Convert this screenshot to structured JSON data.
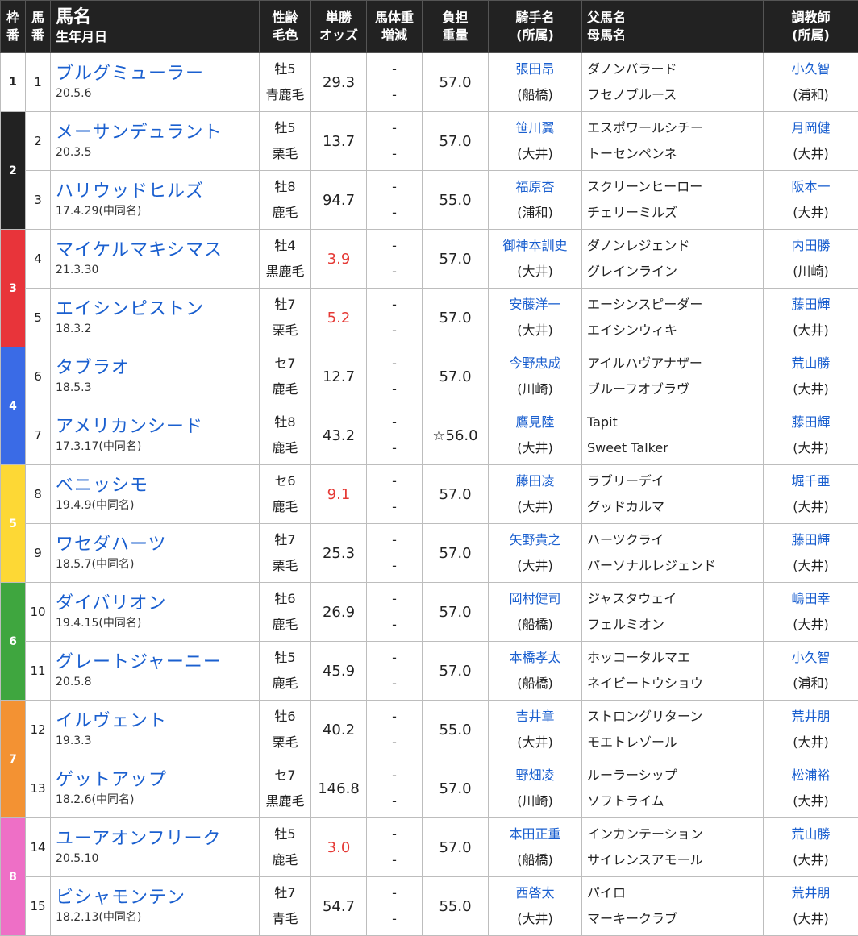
{
  "header": {
    "waku": [
      "枠",
      "番"
    ],
    "umaban": [
      "馬",
      "番"
    ],
    "name": [
      "馬名",
      "生年月日"
    ],
    "sexage": [
      "性齢",
      "毛色"
    ],
    "odds": [
      "単勝",
      "オッズ"
    ],
    "weight": [
      "馬体重",
      "増減"
    ],
    "burden": [
      "負担",
      "重量"
    ],
    "jockey": [
      "騎手名",
      "(所属)"
    ],
    "parents": [
      "父馬名",
      "母馬名"
    ],
    "trainer": [
      "調教師",
      "(所属)"
    ]
  },
  "frame_colors": [
    "#ffffff",
    "#222222",
    "#e8343a",
    "#3a6be6",
    "#fdd835",
    "#3fa63f",
    "#f39233",
    "#ee6fc6"
  ],
  "frames": [
    {
      "label": "1",
      "rows": 1
    },
    {
      "label": "2",
      "rows": 2
    },
    {
      "label": "3",
      "rows": 2
    },
    {
      "label": "4",
      "rows": 2
    },
    {
      "label": "5",
      "rows": 2
    },
    {
      "label": "6",
      "rows": 2
    },
    {
      "label": "7",
      "rows": 2
    },
    {
      "label": "8",
      "rows": 2
    }
  ],
  "rows": [
    {
      "uma": "1",
      "name": "ブルグミューラー",
      "birth": "20.5.6",
      "sex": "牡5",
      "color": "青鹿毛",
      "odds": "29.3",
      "fav": false,
      "w1": "-",
      "w2": "-",
      "burden": "57.0",
      "jockey": "張田昂",
      "jaff": "(船橋)",
      "sire": "ダノンバラード",
      "dam": "フセノブルース",
      "trainer": "小久智",
      "taff": "(浦和)"
    },
    {
      "uma": "2",
      "name": "メーサンデュラント",
      "birth": "20.3.5",
      "sex": "牡5",
      "color": "栗毛",
      "odds": "13.7",
      "fav": false,
      "w1": "-",
      "w2": "-",
      "burden": "57.0",
      "jockey": "笹川翼",
      "jaff": "(大井)",
      "sire": "エスポワールシチー",
      "dam": "トーセンペンネ",
      "trainer": "月岡健",
      "taff": "(大井)"
    },
    {
      "uma": "3",
      "name": "ハリウッドヒルズ",
      "birth": "17.4.29(中同名)",
      "sex": "牡8",
      "color": "鹿毛",
      "odds": "94.7",
      "fav": false,
      "w1": "-",
      "w2": "-",
      "burden": "55.0",
      "jockey": "福原杏",
      "jaff": "(浦和)",
      "sire": "スクリーンヒーロー",
      "dam": "チェリーミルズ",
      "trainer": "阪本一",
      "taff": "(大井)"
    },
    {
      "uma": "4",
      "name": "マイケルマキシマス",
      "birth": "21.3.30",
      "sex": "牡4",
      "color": "黒鹿毛",
      "odds": "3.9",
      "fav": true,
      "w1": "-",
      "w2": "-",
      "burden": "57.0",
      "jockey": "御神本訓史",
      "jaff": "(大井)",
      "sire": "ダノンレジェンド",
      "dam": "グレインライン",
      "trainer": "内田勝",
      "taff": "(川崎)"
    },
    {
      "uma": "5",
      "name": "エイシンピストン",
      "birth": "18.3.2",
      "sex": "牡7",
      "color": "栗毛",
      "odds": "5.2",
      "fav": true,
      "w1": "-",
      "w2": "-",
      "burden": "57.0",
      "jockey": "安藤洋一",
      "jaff": "(大井)",
      "sire": "エーシンスピーダー",
      "dam": "エイシンウィキ",
      "trainer": "藤田輝",
      "taff": "(大井)"
    },
    {
      "uma": "6",
      "name": "タブラオ",
      "birth": "18.5.3",
      "sex": "セ7",
      "color": "鹿毛",
      "odds": "12.7",
      "fav": false,
      "w1": "-",
      "w2": "-",
      "burden": "57.0",
      "jockey": "今野忠成",
      "jaff": "(川崎)",
      "sire": "アイルハヴアナザー",
      "dam": "ブルーフオブラヴ",
      "trainer": "荒山勝",
      "taff": "(大井)"
    },
    {
      "uma": "7",
      "name": "アメリカンシード",
      "birth": "17.3.17(中同名)",
      "sex": "牡8",
      "color": "鹿毛",
      "odds": "43.2",
      "fav": false,
      "w1": "-",
      "w2": "-",
      "burden": "☆56.0",
      "jockey": "鷹見陸",
      "jaff": "(大井)",
      "sire": "Tapit",
      "dam": "Sweet Talker",
      "trainer": "藤田輝",
      "taff": "(大井)"
    },
    {
      "uma": "8",
      "name": "ベニッシモ",
      "birth": "19.4.9(中同名)",
      "sex": "セ6",
      "color": "鹿毛",
      "odds": "9.1",
      "fav": true,
      "w1": "-",
      "w2": "-",
      "burden": "57.0",
      "jockey": "藤田凌",
      "jaff": "(大井)",
      "sire": "ラブリーデイ",
      "dam": "グッドカルマ",
      "trainer": "堀千亜",
      "taff": "(大井)"
    },
    {
      "uma": "9",
      "name": "ワセダハーツ",
      "birth": "18.5.7(中同名)",
      "sex": "牡7",
      "color": "栗毛",
      "odds": "25.3",
      "fav": false,
      "w1": "-",
      "w2": "-",
      "burden": "57.0",
      "jockey": "矢野貴之",
      "jaff": "(大井)",
      "sire": "ハーツクライ",
      "dam": "パーソナルレジェンド",
      "trainer": "藤田輝",
      "taff": "(大井)"
    },
    {
      "uma": "10",
      "name": "ダイバリオン",
      "birth": "19.4.15(中同名)",
      "sex": "牡6",
      "color": "鹿毛",
      "odds": "26.9",
      "fav": false,
      "w1": "-",
      "w2": "-",
      "burden": "57.0",
      "jockey": "岡村健司",
      "jaff": "(船橋)",
      "sire": "ジャスタウェイ",
      "dam": "フェルミオン",
      "trainer": "嶋田幸",
      "taff": "(大井)"
    },
    {
      "uma": "11",
      "name": "グレートジャーニー",
      "birth": "20.5.8",
      "sex": "牡5",
      "color": "鹿毛",
      "odds": "45.9",
      "fav": false,
      "w1": "-",
      "w2": "-",
      "burden": "57.0",
      "jockey": "本橋孝太",
      "jaff": "(船橋)",
      "sire": "ホッコータルマエ",
      "dam": "ネイビートウショウ",
      "trainer": "小久智",
      "taff": "(浦和)"
    },
    {
      "uma": "12",
      "name": "イルヴェント",
      "birth": "19.3.3",
      "sex": "牡6",
      "color": "栗毛",
      "odds": "40.2",
      "fav": false,
      "w1": "-",
      "w2": "-",
      "burden": "55.0",
      "jockey": "吉井章",
      "jaff": "(大井)",
      "sire": "ストロングリターン",
      "dam": "モエトレゾール",
      "trainer": "荒井朋",
      "taff": "(大井)"
    },
    {
      "uma": "13",
      "name": "ゲットアップ",
      "birth": "18.2.6(中同名)",
      "sex": "セ7",
      "color": "黒鹿毛",
      "odds": "146.8",
      "fav": false,
      "w1": "-",
      "w2": "-",
      "burden": "57.0",
      "jockey": "野畑凌",
      "jaff": "(川崎)",
      "sire": "ルーラーシップ",
      "dam": "ソフトライム",
      "trainer": "松浦裕",
      "taff": "(大井)"
    },
    {
      "uma": "14",
      "name": "ユーアオンフリーク",
      "birth": "20.5.10",
      "sex": "牡5",
      "color": "鹿毛",
      "odds": "3.0",
      "fav": true,
      "w1": "-",
      "w2": "-",
      "burden": "57.0",
      "jockey": "本田正重",
      "jaff": "(船橋)",
      "sire": "インカンテーション",
      "dam": "サイレンスアモール",
      "trainer": "荒山勝",
      "taff": "(大井)"
    },
    {
      "uma": "15",
      "name": "ビシャモンテン",
      "birth": "18.2.13(中同名)",
      "sex": "牡7",
      "color": "青毛",
      "odds": "54.7",
      "fav": false,
      "w1": "-",
      "w2": "-",
      "burden": "55.0",
      "jockey": "西啓太",
      "jaff": "(大井)",
      "sire": "パイロ",
      "dam": "マーキークラブ",
      "trainer": "荒井朋",
      "taff": "(大井)"
    }
  ]
}
